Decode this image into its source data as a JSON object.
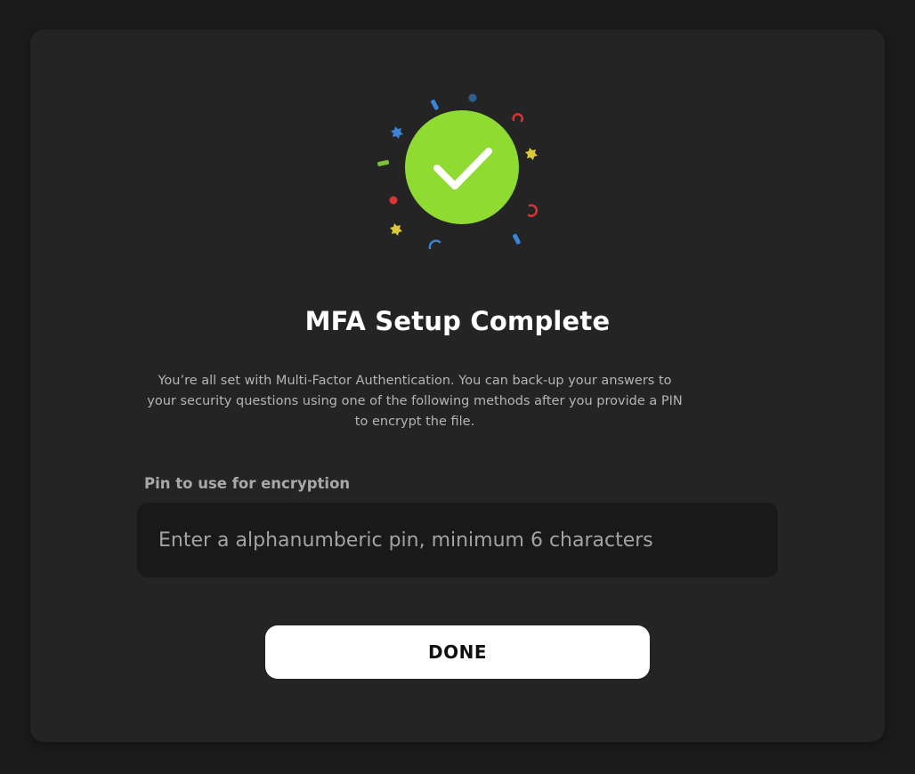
{
  "dialog": {
    "title": "MFA Setup Complete",
    "description": "You’re all set with Multi-Factor Authentication. You can back-up your answers to your security questions using one of the following methods after you provide a PIN to encrypt the file.",
    "pin_field": {
      "label": "Pin to use for encryption",
      "value": "",
      "placeholder": "Enter a alphanumberic pin, minimum 6 characters"
    },
    "done_label": "DONE",
    "success_icon": "check-circle-icon"
  },
  "colors": {
    "page_background": "#1b1b1b",
    "card_background": "#242424",
    "input_background": "#191919",
    "success_green": "#8fdb32",
    "confetti_blue": "#3a86d6",
    "confetti_red": "#d93535",
    "confetti_yellow": "#dcc93a",
    "confetti_green": "#7fc23a",
    "button_background": "#ffffff"
  }
}
